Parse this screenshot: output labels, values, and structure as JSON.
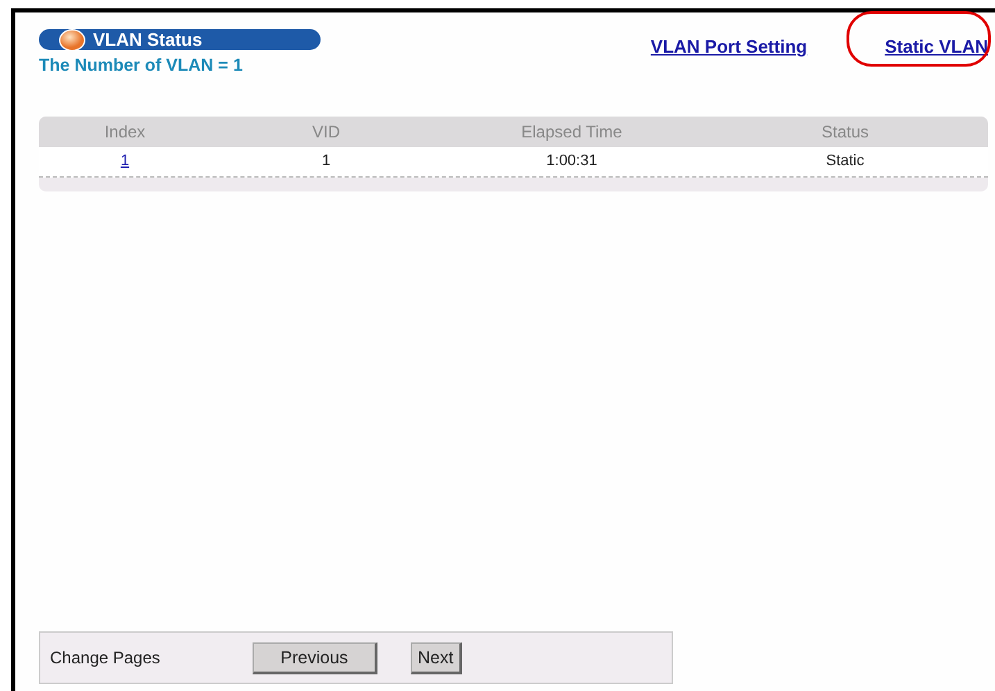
{
  "banner": {
    "title": "VLAN Status"
  },
  "summary": "The Number of VLAN = 1",
  "links": [
    {
      "label": "VLAN Port Setting",
      "highlighted": false
    },
    {
      "label": "Static VLAN",
      "highlighted": true
    }
  ],
  "table": {
    "columns": [
      "Index",
      "VID",
      "Elapsed Time",
      "Status"
    ],
    "rows": [
      {
        "index": "1",
        "vid": "1",
        "elapsed_time": "1:00:31",
        "status": "Static"
      }
    ]
  },
  "footer": {
    "label": "Change Pages",
    "buttons": [
      "Previous",
      "Next"
    ]
  }
}
